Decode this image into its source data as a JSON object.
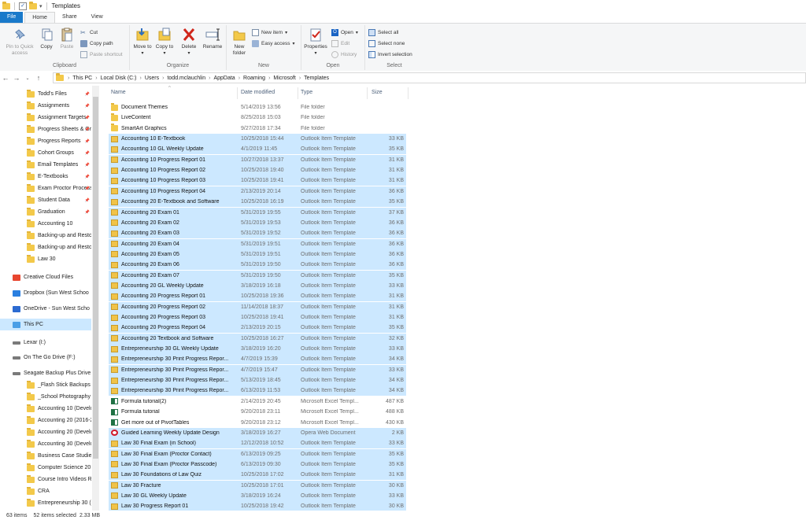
{
  "window": {
    "title": "Templates"
  },
  "ribbon_tabs": [
    "File",
    "Home",
    "Share",
    "View"
  ],
  "ribbon": {
    "clipboard": {
      "label": "Clipboard",
      "pin": "Pin to Quick access",
      "copy": "Copy",
      "paste": "Paste",
      "cut": "Cut",
      "copy_path": "Copy path",
      "paste_shortcut": "Paste shortcut"
    },
    "organize": {
      "label": "Organize",
      "move_to": "Move to",
      "copy_to": "Copy to",
      "delete": "Delete",
      "rename": "Rename"
    },
    "new": {
      "label": "New",
      "new_folder": "New folder",
      "new_item": "New item",
      "easy_access": "Easy access"
    },
    "open": {
      "label": "Open",
      "properties": "Properties",
      "open": "Open",
      "edit": "Edit",
      "history": "History"
    },
    "select": {
      "label": "Select",
      "select_all": "Select all",
      "select_none": "Select none",
      "invert": "Invert selection"
    }
  },
  "breadcrumbs": [
    "This PC",
    "Local Disk (C:)",
    "Users",
    "todd.mclauchlin",
    "AppData",
    "Roaming",
    "Microsoft",
    "Templates"
  ],
  "nav_items": [
    {
      "label": "Todd's Files",
      "pinned": true
    },
    {
      "label": "Assignments",
      "pinned": true
    },
    {
      "label": "Assignment Targets",
      "pinned": true
    },
    {
      "label": "Progress Sheets & Gra",
      "pinned": true
    },
    {
      "label": "Progress Reports",
      "pinned": true
    },
    {
      "label": "Cohort Groups",
      "pinned": true
    },
    {
      "label": "Email Templates",
      "pinned": true
    },
    {
      "label": "E-Textbooks",
      "pinned": true
    },
    {
      "label": "Exam Proctor Process",
      "pinned": true
    },
    {
      "label": "Student Data",
      "pinned": true
    },
    {
      "label": "Graduation",
      "pinned": true
    },
    {
      "label": "Accounting 10",
      "pinned": false
    },
    {
      "label": "Backing-up and Restorin",
      "pinned": false
    },
    {
      "label": "Backing-up and Restorin",
      "pinned": false
    },
    {
      "label": "Law 30",
      "pinned": false
    },
    {
      "label": "Creative Cloud Files",
      "pinned": false
    },
    {
      "label": "Dropbox (Sun West Schoo",
      "pinned": false
    },
    {
      "label": "OneDrive - Sun West Scho",
      "pinned": false
    },
    {
      "label": "This PC",
      "pinned": false
    },
    {
      "label": "Lexar (I:)",
      "pinned": false
    },
    {
      "label": "On The Go Drive (F:)",
      "pinned": false
    },
    {
      "label": "Seagate Backup Plus Drive",
      "pinned": false
    },
    {
      "label": "_Flash Stick Backups",
      "pinned": false
    },
    {
      "label": "_School Photography",
      "pinned": false
    },
    {
      "label": "Accounting 10 (Develop",
      "pinned": false
    },
    {
      "label": "Accounting 20 (2016-201",
      "pinned": false
    },
    {
      "label": "Accounting 20 (Develop",
      "pinned": false
    },
    {
      "label": "Accounting 30 (Develop",
      "pinned": false
    },
    {
      "label": "Business Case Studies",
      "pinned": false
    },
    {
      "label": "Computer Science 20 (De",
      "pinned": false
    },
    {
      "label": "Course Intro Videos Raw",
      "pinned": false
    },
    {
      "label": "CRA",
      "pinned": false
    },
    {
      "label": "Entrepreneurship 30 (Dev",
      "pinned": false
    }
  ],
  "columns": {
    "name": "Name",
    "date": "Date modified",
    "type": "Type",
    "size": "Size"
  },
  "files": [
    {
      "name": "Document Themes",
      "date": "5/14/2019 13:56",
      "type": "File folder",
      "size": "",
      "icon": "folder-icon",
      "selected": false
    },
    {
      "name": "LiveContent",
      "date": "8/25/2018 15:03",
      "type": "File folder",
      "size": "",
      "icon": "folder-icon",
      "selected": false
    },
    {
      "name": "SmartArt Graphics",
      "date": "9/27/2018 17:34",
      "type": "File folder",
      "size": "",
      "icon": "folder-icon",
      "selected": false
    },
    {
      "name": "Accounting 10 E-Textbook",
      "date": "10/25/2018 15:44",
      "type": "Outlook Item Template",
      "size": "33 KB",
      "icon": "outlook-template-icon",
      "selected": true
    },
    {
      "name": "Accounting 10 GL Weekly Update",
      "date": "4/1/2019 11:45",
      "type": "Outlook Item Template",
      "size": "35 KB",
      "icon": "outlook-template-icon",
      "selected": true
    },
    {
      "name": "Accounting 10 Progress Report 01",
      "date": "10/27/2018 13:37",
      "type": "Outlook Item Template",
      "size": "31 KB",
      "icon": "outlook-template-icon",
      "selected": true
    },
    {
      "name": "Accounting 10 Progress Report 02",
      "date": "10/25/2018 19:40",
      "type": "Outlook Item Template",
      "size": "31 KB",
      "icon": "outlook-template-icon",
      "selected": true
    },
    {
      "name": "Accounting 10 Progress Report 03",
      "date": "10/25/2018 19:41",
      "type": "Outlook Item Template",
      "size": "31 KB",
      "icon": "outlook-template-icon",
      "selected": true
    },
    {
      "name": "Accounting 10 Progress Report 04",
      "date": "2/13/2019 20:14",
      "type": "Outlook Item Template",
      "size": "36 KB",
      "icon": "outlook-template-icon",
      "selected": true
    },
    {
      "name": "Accounting 20 E-Textbook and Software",
      "date": "10/25/2018 16:19",
      "type": "Outlook Item Template",
      "size": "35 KB",
      "icon": "outlook-template-icon",
      "selected": true
    },
    {
      "name": "Accounting 20 Exam 01",
      "date": "5/31/2019 19:55",
      "type": "Outlook Item Template",
      "size": "37 KB",
      "icon": "outlook-template-icon",
      "selected": true
    },
    {
      "name": "Accounting 20 Exam 02",
      "date": "5/31/2019 19:53",
      "type": "Outlook Item Template",
      "size": "36 KB",
      "icon": "outlook-template-icon",
      "selected": true
    },
    {
      "name": "Accounting 20 Exam 03",
      "date": "5/31/2019 19:52",
      "type": "Outlook Item Template",
      "size": "36 KB",
      "icon": "outlook-template-icon",
      "selected": true
    },
    {
      "name": "Accounting 20 Exam 04",
      "date": "5/31/2019 19:51",
      "type": "Outlook Item Template",
      "size": "36 KB",
      "icon": "outlook-template-icon",
      "selected": true
    },
    {
      "name": "Accounting 20 Exam 05",
      "date": "5/31/2019 19:51",
      "type": "Outlook Item Template",
      "size": "36 KB",
      "icon": "outlook-template-icon",
      "selected": true
    },
    {
      "name": "Accounting 20 Exam 06",
      "date": "5/31/2019 19:50",
      "type": "Outlook Item Template",
      "size": "36 KB",
      "icon": "outlook-template-icon",
      "selected": true
    },
    {
      "name": "Accounting 20 Exam 07",
      "date": "5/31/2019 19:50",
      "type": "Outlook Item Template",
      "size": "35 KB",
      "icon": "outlook-template-icon",
      "selected": true
    },
    {
      "name": "Accounting 20 GL Weekly Update",
      "date": "3/18/2019 16:18",
      "type": "Outlook Item Template",
      "size": "33 KB",
      "icon": "outlook-template-icon",
      "selected": true
    },
    {
      "name": "Accounting 20 Progress Report 01",
      "date": "10/25/2018 19:36",
      "type": "Outlook Item Template",
      "size": "31 KB",
      "icon": "outlook-template-icon",
      "selected": true
    },
    {
      "name": "Accounting 20 Progress Report 02",
      "date": "11/14/2018 18:37",
      "type": "Outlook Item Template",
      "size": "31 KB",
      "icon": "outlook-template-icon",
      "selected": true
    },
    {
      "name": "Accounting 20 Progress Report 03",
      "date": "10/25/2018 19:41",
      "type": "Outlook Item Template",
      "size": "31 KB",
      "icon": "outlook-template-icon",
      "selected": true
    },
    {
      "name": "Accounting 20 Progress Report 04",
      "date": "2/13/2019 20:15",
      "type": "Outlook Item Template",
      "size": "35 KB",
      "icon": "outlook-template-icon",
      "selected": true
    },
    {
      "name": "Accounting 20 Textbook and Software",
      "date": "10/25/2018 16:27",
      "type": "Outlook Item Template",
      "size": "32 KB",
      "icon": "outlook-template-icon",
      "selected": true
    },
    {
      "name": "Entrepreneurship 30 GL Weekly Update",
      "date": "3/18/2019 16:20",
      "type": "Outlook Item Template",
      "size": "33 KB",
      "icon": "outlook-template-icon",
      "selected": true
    },
    {
      "name": "Entrepreneurship 30 Print Progress Repor...",
      "date": "4/7/2019 15:39",
      "type": "Outlook Item Template",
      "size": "34 KB",
      "icon": "outlook-template-icon",
      "selected": true
    },
    {
      "name": "Entrepreneurship 30 Print Progress Repor...",
      "date": "4/7/2019 15:47",
      "type": "Outlook Item Template",
      "size": "33 KB",
      "icon": "outlook-template-icon",
      "selected": true
    },
    {
      "name": "Entrepreneurship 30 Print Progress Repor...",
      "date": "5/13/2019 18:45",
      "type": "Outlook Item Template",
      "size": "34 KB",
      "icon": "outlook-template-icon",
      "selected": true
    },
    {
      "name": "Entrepreneurship 30 Print Progress Repor...",
      "date": "6/13/2019 11:53",
      "type": "Outlook Item Template",
      "size": "34 KB",
      "icon": "outlook-template-icon",
      "selected": true
    },
    {
      "name": "Formula tutorial(2)",
      "date": "2/14/2019 20:45",
      "type": "Microsoft Excel Templ...",
      "size": "487 KB",
      "icon": "excel-template-icon",
      "selected": false
    },
    {
      "name": "Formula tutorial",
      "date": "9/20/2018 23:11",
      "type": "Microsoft Excel Templ...",
      "size": "488 KB",
      "icon": "excel-template-icon",
      "selected": false
    },
    {
      "name": "Get more out of PivotTables",
      "date": "9/20/2018 23:12",
      "type": "Microsoft Excel Templ...",
      "size": "430 KB",
      "icon": "excel-template-icon",
      "selected": false
    },
    {
      "name": "Guided Learning Weekly Update Design",
      "date": "3/18/2019 16:27",
      "type": "Opera Web Document",
      "size": "2 KB",
      "icon": "opera-document-icon",
      "selected": true
    },
    {
      "name": "Law 30 Final Exam (in School)",
      "date": "12/12/2018 10:52",
      "type": "Outlook Item Template",
      "size": "33 KB",
      "icon": "outlook-template-icon",
      "selected": true
    },
    {
      "name": "Law 30 Final Exam (Proctor Contact)",
      "date": "6/13/2019 09:25",
      "type": "Outlook Item Template",
      "size": "35 KB",
      "icon": "outlook-template-icon",
      "selected": true
    },
    {
      "name": "Law 30 Final Exam (Proctor Passcode)",
      "date": "6/13/2019 09:30",
      "type": "Outlook Item Template",
      "size": "35 KB",
      "icon": "outlook-template-icon",
      "selected": true
    },
    {
      "name": "Law 30 Foundations of Law Quiz",
      "date": "10/25/2018 17:02",
      "type": "Outlook Item Template",
      "size": "31 KB",
      "icon": "outlook-template-icon",
      "selected": true
    },
    {
      "name": "Law 30 Fracture",
      "date": "10/25/2018 17:01",
      "type": "Outlook Item Template",
      "size": "30 KB",
      "icon": "outlook-template-icon",
      "selected": true
    },
    {
      "name": "Law 30 GL Weekly Update",
      "date": "3/18/2019 16:24",
      "type": "Outlook Item Template",
      "size": "33 KB",
      "icon": "outlook-template-icon",
      "selected": true
    },
    {
      "name": "Law 30 Progress Report 01",
      "date": "10/25/2018 19:42",
      "type": "Outlook Item Template",
      "size": "30 KB",
      "icon": "outlook-template-icon",
      "selected": true
    }
  ],
  "status": {
    "items": "63 items",
    "selected": "52 items selected",
    "size": "2.33 MB"
  },
  "colors": {
    "accent": "#1979ca",
    "selection": "#cce8ff",
    "folder": "#f3c94a"
  }
}
